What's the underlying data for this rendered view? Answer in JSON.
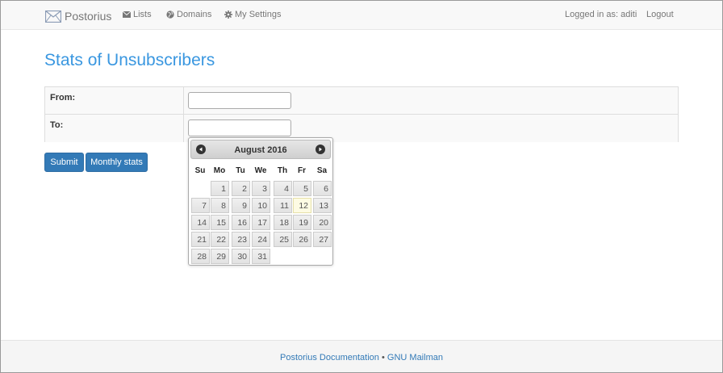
{
  "navbar": {
    "brand": "Postorius",
    "lists": "Lists",
    "domains": "Domains",
    "settings": "My Settings",
    "logged_in": "Logged in as: aditi",
    "logout": "Logout"
  },
  "page": {
    "title": "Stats of Unsubscribers"
  },
  "form": {
    "from_label": "From:",
    "to_label": "To:",
    "from_value": "",
    "to_value": ""
  },
  "buttons": {
    "submit": "Submit",
    "monthly": "Monthly stats"
  },
  "datepicker": {
    "month": "August",
    "year": "2016",
    "weekdays": [
      "Su",
      "Mo",
      "Tu",
      "We",
      "Th",
      "Fr",
      "Sa"
    ],
    "first_weekday_index": 1,
    "days_in_month": 31,
    "today": 12
  },
  "footer": {
    "doc_link": "Postorius Documentation",
    "separator": "•",
    "mailman_link": "GNU Mailman"
  },
  "colors": {
    "title": "#3a97e0",
    "button": "#337ab7",
    "today_highlight": "#fdfbe3"
  }
}
